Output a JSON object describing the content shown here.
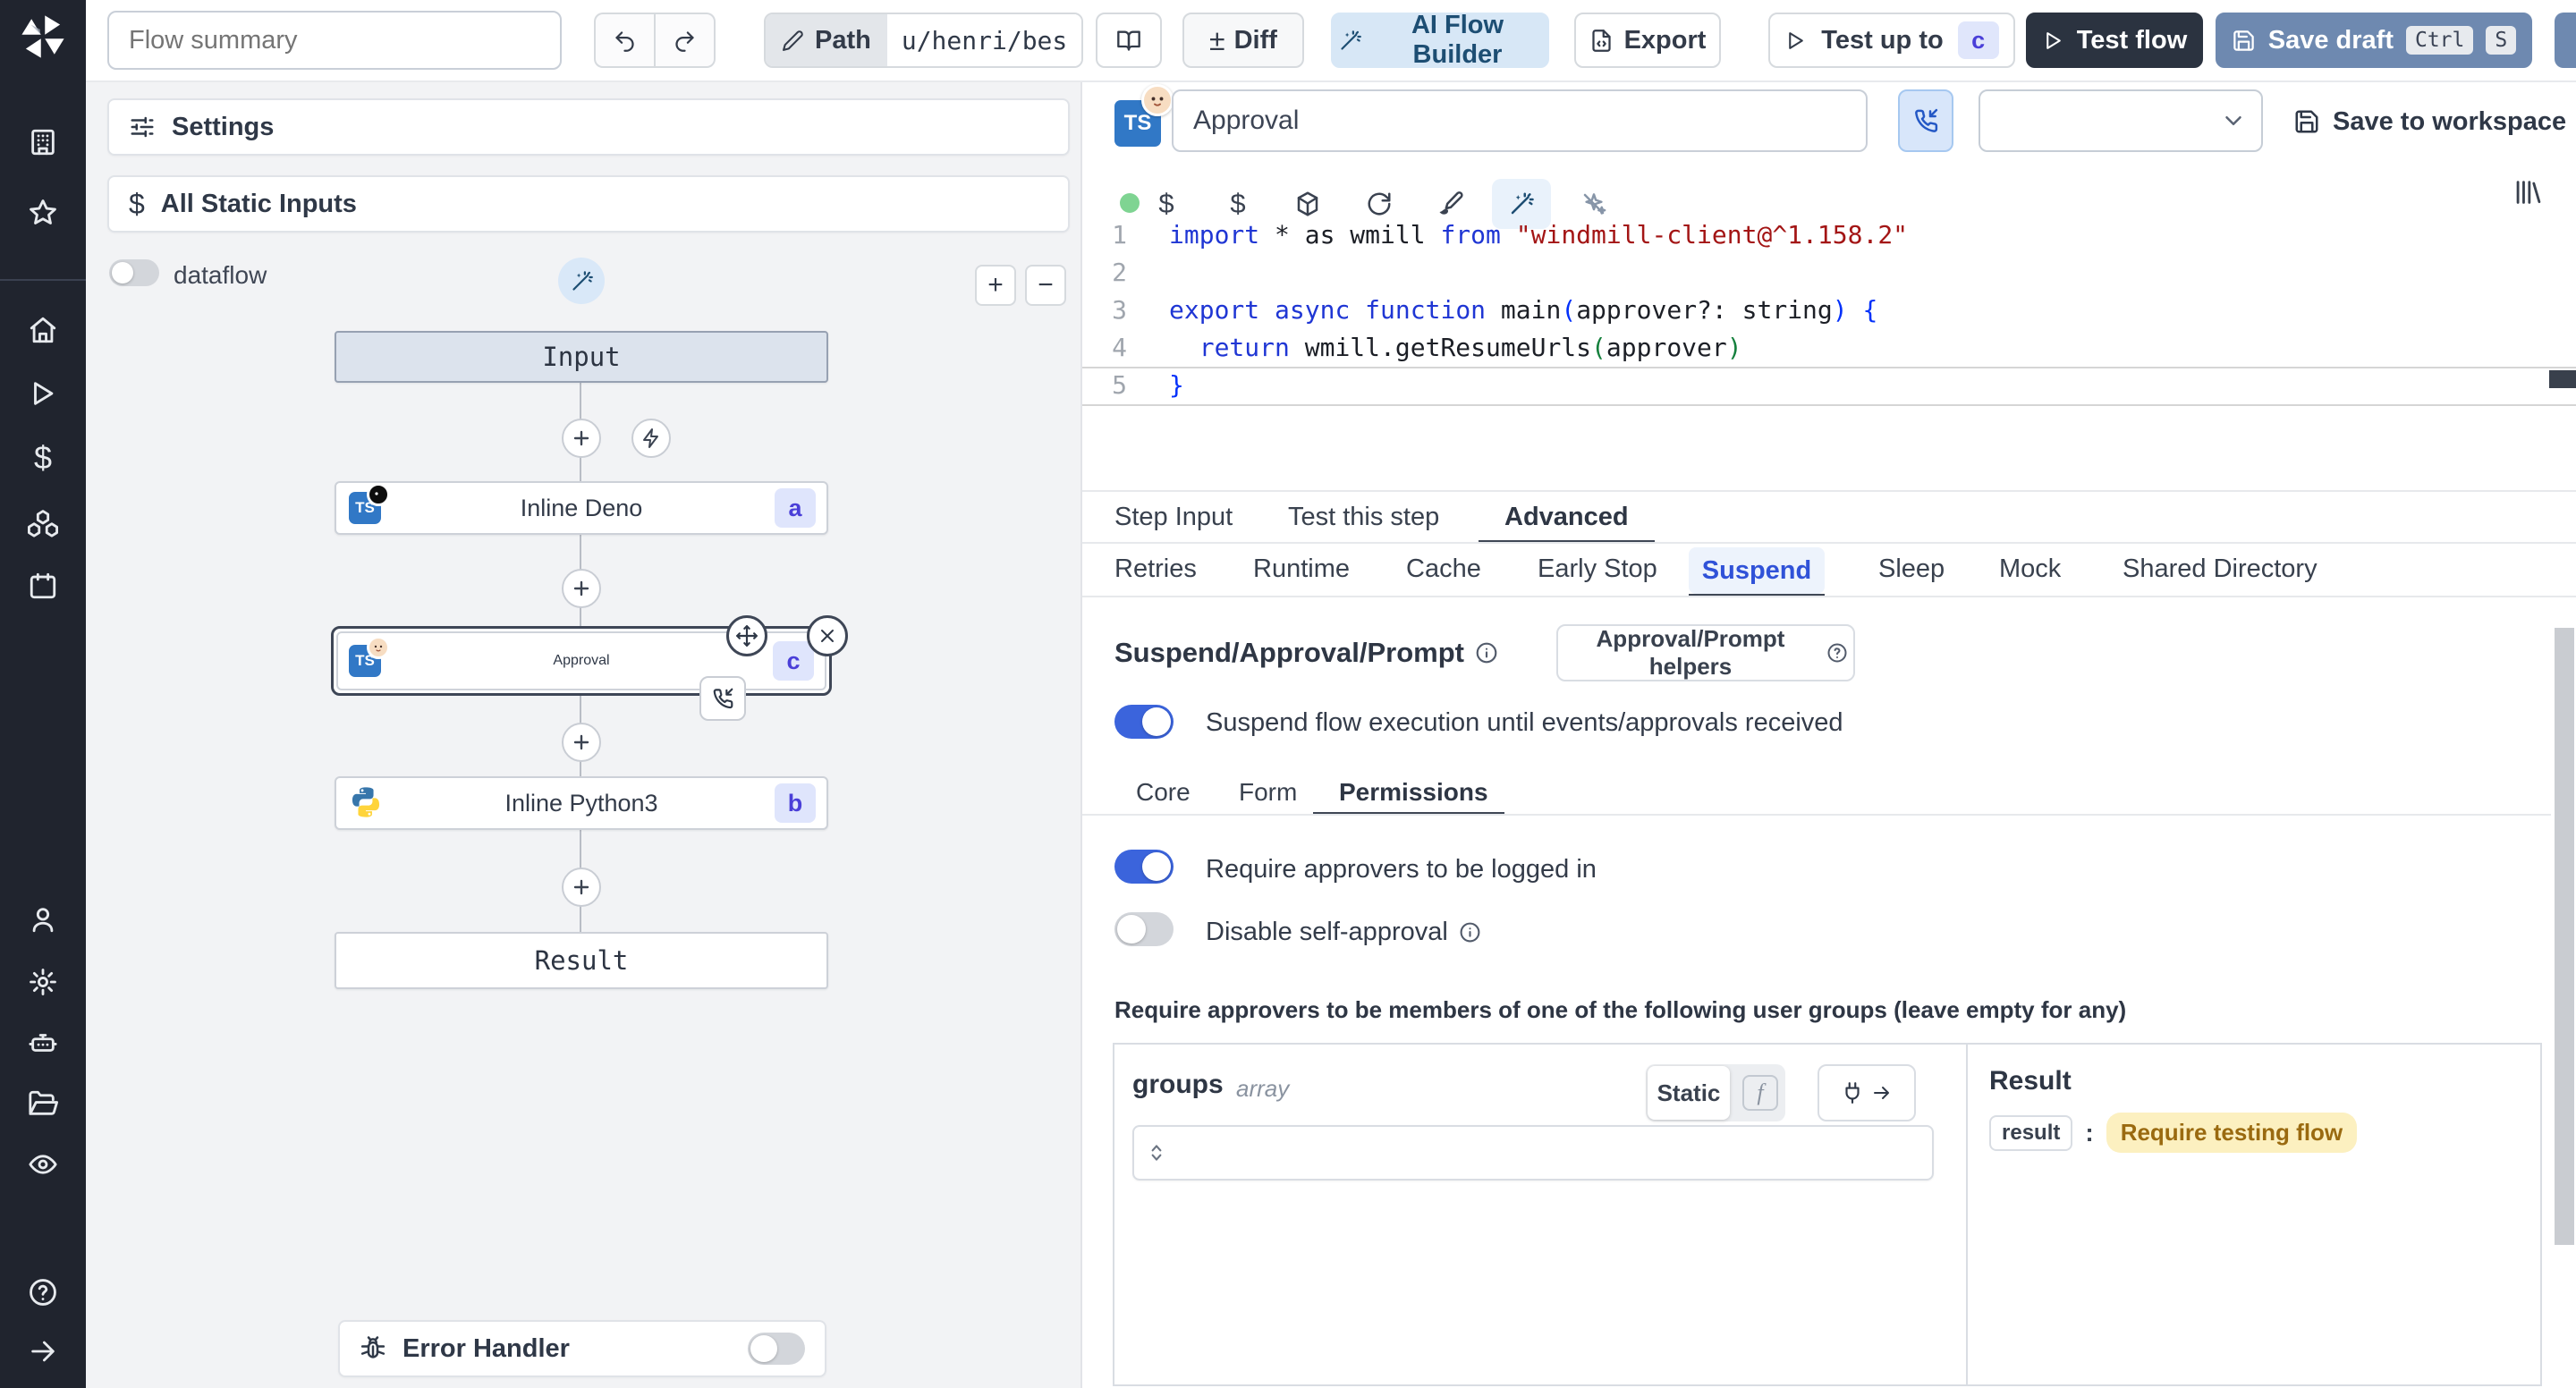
{
  "topbar": {
    "flow_summary_placeholder": "Flow summary",
    "path_label": "Path",
    "path_value": "u/henri/bes",
    "diff_label": "Diff",
    "diff_sign": "±",
    "ai_flow_builder_label": "AI Flow Builder",
    "export_label": "Export",
    "test_up_to_label": "Test up to",
    "test_up_to_badge": "c",
    "test_flow_label": "Test flow",
    "save_draft_label": "Save draft",
    "save_draft_kbd": [
      "Ctrl",
      "S"
    ]
  },
  "sidebar": {
    "icons": [
      "building",
      "star",
      "home",
      "play",
      "dollar",
      "boxes",
      "calendar",
      "user",
      "settings",
      "robot",
      "folder-open",
      "eye",
      "help",
      "arrow-right"
    ]
  },
  "left_panel": {
    "settings_label": "Settings",
    "all_static_inputs_label": "All Static Inputs",
    "dataflow_label": "dataflow",
    "dataflow_enabled": false,
    "zoom_in": "+",
    "zoom_out": "−",
    "graph": {
      "input_label": "Input",
      "result_label": "Result",
      "nodes": [
        {
          "label": "Inline Deno",
          "badge": "a"
        },
        {
          "label": "Approval",
          "badge": "c"
        },
        {
          "label": "Inline Python3",
          "badge": "b"
        }
      ]
    },
    "error_handler_label": "Error Handler",
    "error_handler_enabled": false
  },
  "step_editor": {
    "name_value": "Approval",
    "save_to_workspace_label": "Save to workspace",
    "code": {
      "line_numbers": [
        "1",
        "2",
        "3",
        "4",
        "5"
      ],
      "lines": [
        [
          [
            "kw",
            "import"
          ],
          [
            "df",
            " * as wmill "
          ],
          [
            "kw",
            "from"
          ],
          [
            "df",
            " "
          ],
          [
            "str",
            "\"windmill-client@^1.158.2\""
          ]
        ],
        [],
        [
          [
            "kw",
            "export"
          ],
          [
            "df",
            " "
          ],
          [
            "kw",
            "async"
          ],
          [
            "df",
            " "
          ],
          [
            "kw",
            "function"
          ],
          [
            "df",
            " main"
          ],
          [
            "pb",
            "("
          ],
          [
            "df",
            "approver?: string"
          ],
          [
            "pb",
            ")"
          ],
          [
            "df",
            " "
          ],
          [
            "pb",
            "{"
          ]
        ],
        [
          [
            "df",
            "  "
          ],
          [
            "kw",
            "return"
          ],
          [
            "df",
            " wmill.getResumeUrls"
          ],
          [
            "pg",
            "("
          ],
          [
            "df",
            "approver"
          ],
          [
            "pg",
            ")"
          ]
        ],
        [
          [
            "pb",
            "}"
          ]
        ]
      ]
    },
    "tabs": [
      "Step Input",
      "Test this step",
      "Advanced"
    ],
    "active_tab": "Advanced",
    "advanced_tabs": [
      "Retries",
      "Runtime",
      "Cache",
      "Early Stop",
      "Suspend",
      "Sleep",
      "Mock",
      "Shared Directory"
    ],
    "active_advanced_tab": "Suspend",
    "suspend": {
      "title": "Suspend/Approval/Prompt",
      "helpers_button": "Approval/Prompt helpers",
      "suspend_enabled": true,
      "suspend_toggle_label": "Suspend flow execution until events/approvals received",
      "sub_tabs": [
        "Core",
        "Form",
        "Permissions"
      ],
      "active_sub_tab": "Permissions",
      "require_login_enabled": true,
      "require_login_label": "Require approvers to be logged in",
      "disable_self_approval_enabled": false,
      "disable_self_approval_label": "Disable self-approval",
      "groups_hint": "Require approvers to be members of one of the following user groups (leave empty for any)",
      "groups_field": {
        "name": "groups",
        "type": "array",
        "static_label": "Static"
      },
      "result": {
        "title": "Result",
        "key": "result",
        "value": "Require testing flow"
      }
    },
    "colors": {
      "accent_blue": "#3b64dc",
      "badge_indigo_bg": "#dfe5fc",
      "badge_indigo_text": "#4a3fd8",
      "result_badge_bg": "#fcf0c0",
      "result_badge_text": "#9a6a10",
      "ts_blue": "#3178c6",
      "save_draft_bg": "#6e89b0",
      "test_flow_bg": "#2b3340"
    }
  }
}
